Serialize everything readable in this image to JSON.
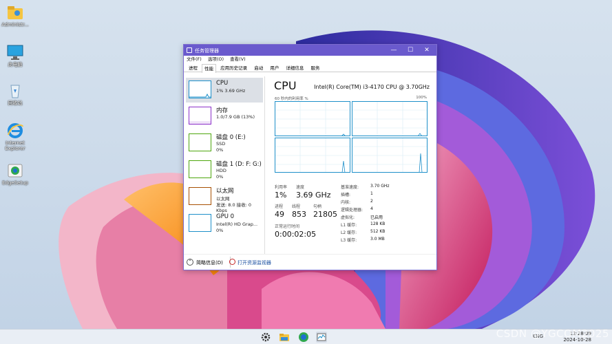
{
  "desktop": {
    "icons": [
      {
        "label": "Administr..."
      },
      {
        "label": "此电脑"
      },
      {
        "label": "回收站"
      },
      {
        "label": "Internet Explorer"
      },
      {
        "label": "EdgeSetup"
      }
    ]
  },
  "window": {
    "title": "任务管理器",
    "controls": {
      "minimize": "—",
      "maximize": "☐",
      "close": "✕"
    },
    "menu": [
      "文件(F)",
      "选项(O)",
      "查看(V)"
    ],
    "tabs": [
      "进程",
      "性能",
      "应用历史记录",
      "启动",
      "用户",
      "详细信息",
      "服务"
    ],
    "active_tab": "性能"
  },
  "resources": [
    {
      "name": "CPU",
      "line2": "1% 3.69 GHz",
      "line3": "",
      "color": "#1d8fc9"
    },
    {
      "name": "内存",
      "line2": "1.0/7.9 GB (13%)",
      "line3": "",
      "color": "#8b2fc9"
    },
    {
      "name": "磁盘 0 (E:)",
      "line2": "SSD",
      "line3": "0%",
      "color": "#4da60c"
    },
    {
      "name": "磁盘 1 (D: F: G:)",
      "line2": "HDD",
      "line3": "0%",
      "color": "#4da60c"
    },
    {
      "name": "以太网",
      "line2": "以太网",
      "line3": "发送: 8.0 接收: 0 Kbps",
      "color": "#a74f01"
    },
    {
      "name": "GPU 0",
      "line2": "Intel(R) HD Grap...",
      "line3": "0%",
      "color": "#1d8fc9"
    }
  ],
  "detail": {
    "title": "CPU",
    "model": "Intel(R) Core(TM) i3-4170 CPU @ 3.70GHz",
    "graph_caption": "60 秒内的利用率 %",
    "graph_max": "100%",
    "stats": {
      "utilization_label": "利用率",
      "utilization": "1%",
      "speed_label": "速度",
      "speed": "3.69 GHz",
      "processes_label": "进程",
      "processes": "49",
      "threads_label": "线程",
      "threads": "853",
      "handles_label": "句柄",
      "handles": "21805",
      "uptime_label": "正常运行时间",
      "uptime": "0:00:02:05"
    },
    "specs": [
      {
        "k": "基准速度:",
        "v": "3.70 GHz"
      },
      {
        "k": "插槽:",
        "v": "1"
      },
      {
        "k": "内核:",
        "v": "2"
      },
      {
        "k": "逻辑处理器:",
        "v": "4"
      },
      {
        "k": "虚拟化:",
        "v": "已启用"
      },
      {
        "k": "L1 缓存:",
        "v": "128 KB"
      },
      {
        "k": "L2 缓存:",
        "v": "512 KB"
      },
      {
        "k": "L3 缓存:",
        "v": "3.0 MB"
      }
    ]
  },
  "footer": {
    "brief": "简略信息(D)",
    "monitor": "打开资源监视器"
  },
  "taskbar": {
    "ime": "ENG",
    "time": "12:28:09",
    "date": "2024-10-28",
    "watermark": "CSDN @YGCOM2025"
  }
}
